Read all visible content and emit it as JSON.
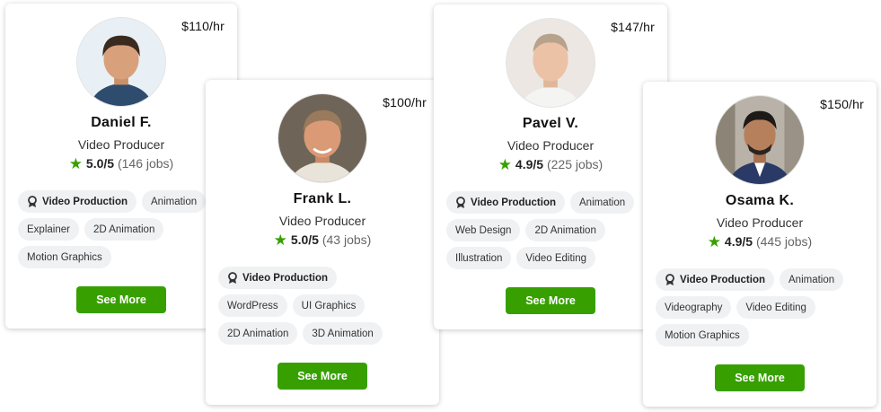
{
  "colors": {
    "accent": "#37a000",
    "tag_bg": "#eff1f3"
  },
  "cards": [
    {
      "rate": "$110/hr",
      "name": "Daniel F.",
      "title": "Video Producer",
      "rating": "5.0/5",
      "jobs": "(146 jobs)",
      "tags": [
        "Video Production",
        "Animation",
        "Explainer",
        "2D Animation",
        "Motion Graphics"
      ],
      "button": "See More"
    },
    {
      "rate": "$100/hr",
      "name": "Frank L.",
      "title": "Video Producer",
      "rating": "5.0/5",
      "jobs": "(43 jobs)",
      "tags": [
        "Video Production",
        "WordPress",
        "UI Graphics",
        "2D Animation",
        "3D Animation"
      ],
      "button": "See More"
    },
    {
      "rate": "$147/hr",
      "name": "Pavel V.",
      "title": "Video Producer",
      "rating": "4.9/5",
      "jobs": "(225 jobs)",
      "tags": [
        "Video Production",
        "Animation",
        "Web Design",
        "2D Animation",
        "Illustration",
        "Video Editing"
      ],
      "button": "See More"
    },
    {
      "rate": "$150/hr",
      "name": "Osama K.",
      "title": "Video Producer",
      "rating": "4.9/5",
      "jobs": "(445 jobs)",
      "tags": [
        "Video Production",
        "Animation",
        "Videography",
        "Video Editing",
        "Motion Graphics"
      ],
      "button": "See More"
    }
  ]
}
